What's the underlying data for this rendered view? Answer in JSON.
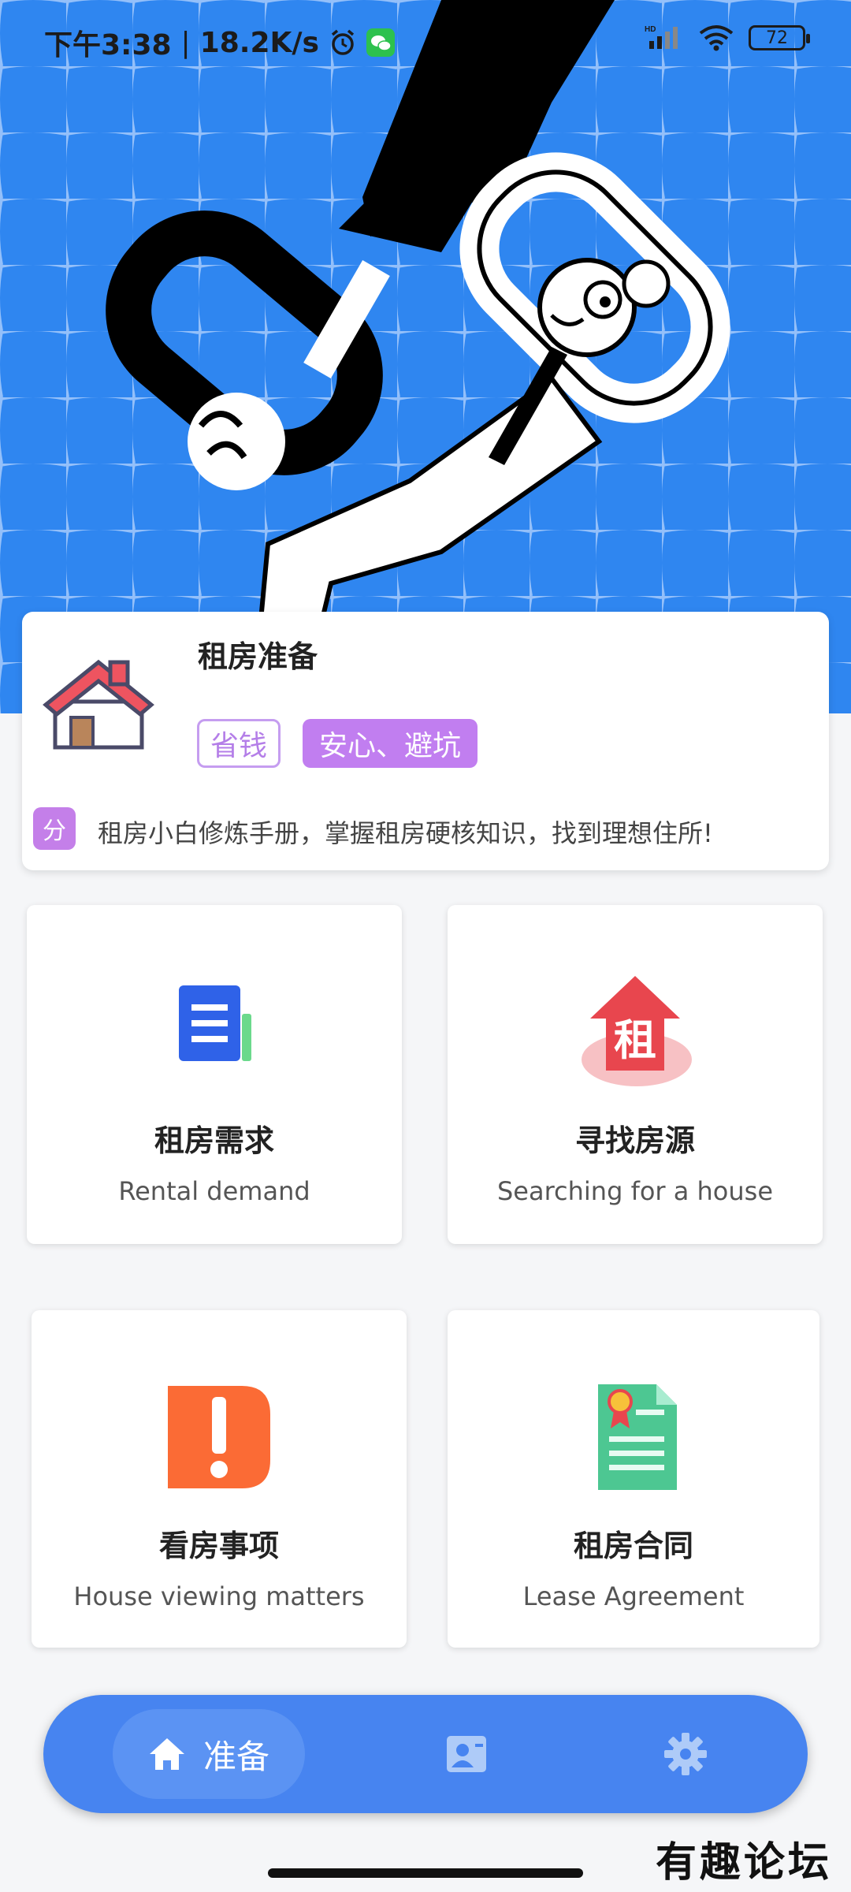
{
  "status_bar": {
    "time": "下午3:38",
    "network_speed": "18.2K/s",
    "battery": "72",
    "icons": [
      "alarm-icon",
      "wechat-icon",
      "hd-signal-icon",
      "wifi-icon",
      "battery-icon"
    ]
  },
  "intro_card": {
    "title": "租房准备",
    "tags": [
      "省钱",
      "安心、避坑"
    ],
    "share_badge": "分",
    "description": "租房小白修炼手册，掌握租房硬核知识，找到理想住所!"
  },
  "features": [
    {
      "title": "租房需求",
      "subtitle": "Rental demand",
      "icon": "document-icon"
    },
    {
      "title": "寻找房源",
      "subtitle": "Searching for a house",
      "icon": "rent-house-icon"
    },
    {
      "title": "看房事项",
      "subtitle": "House viewing matters",
      "icon": "warning-icon"
    },
    {
      "title": "租房合同",
      "subtitle": "Lease Agreement",
      "icon": "contract-icon"
    }
  ],
  "bottom_nav": {
    "active_label": "准备",
    "items": [
      "home-icon",
      "contact-card-icon",
      "settings-icon"
    ]
  },
  "watermark": "有趣论坛",
  "colors": {
    "hero_blue": "#2f86f0",
    "nav_blue": "#4784f0",
    "purple": "#c17ef0"
  }
}
